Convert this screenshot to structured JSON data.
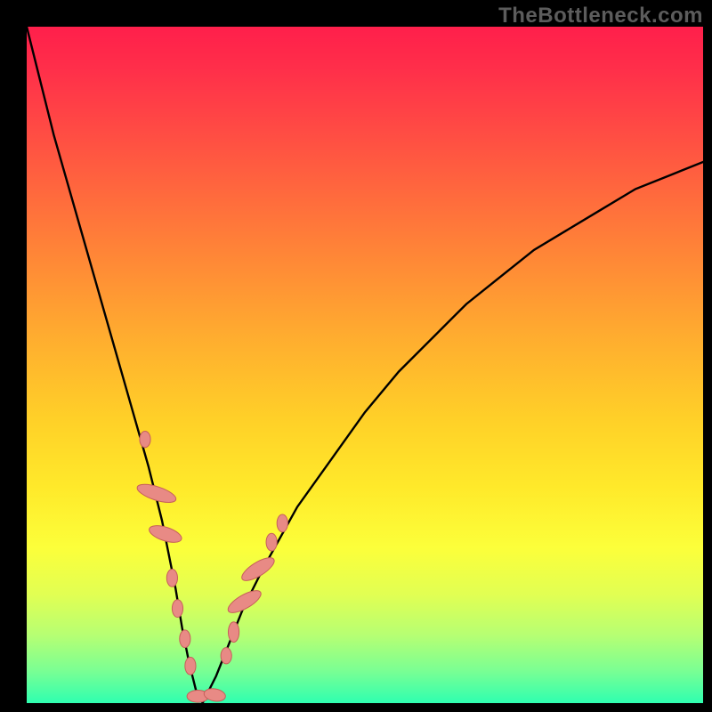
{
  "watermark": "TheBottleneck.com",
  "chart_data": {
    "type": "line",
    "title": "",
    "xlabel": "",
    "ylabel": "",
    "xlim": [
      0,
      100
    ],
    "ylim": [
      0,
      100
    ],
    "grid": false,
    "legend": false,
    "series": [
      {
        "name": "bottleneck-curve",
        "x": [
          0,
          2,
          4,
          6,
          8,
          10,
          12,
          14,
          16,
          18,
          20,
          21,
          22,
          23,
          24,
          25,
          26,
          28,
          30,
          32,
          35,
          40,
          45,
          50,
          55,
          60,
          65,
          70,
          75,
          80,
          85,
          90,
          95,
          100
        ],
        "y": [
          100,
          92,
          84,
          77,
          70,
          63,
          56,
          49,
          42,
          35,
          27,
          22,
          17,
          11,
          6,
          2,
          0,
          4,
          9,
          14,
          20,
          29,
          36,
          43,
          49,
          54,
          59,
          63,
          67,
          70,
          73,
          76,
          78,
          80
        ]
      }
    ],
    "markers": [
      {
        "name": "marker-left-outer",
        "shape": "round",
        "x": 17.5,
        "y": 39,
        "w": 1.6,
        "h": 2.4
      },
      {
        "name": "marker-left-long-1",
        "shape": "pill",
        "x": 19.2,
        "y": 31,
        "w": 2.0,
        "h": 6.0,
        "angle": -72
      },
      {
        "name": "marker-left-long-2",
        "shape": "pill",
        "x": 20.5,
        "y": 25,
        "w": 2.0,
        "h": 5.0,
        "angle": -72
      },
      {
        "name": "marker-left-3",
        "shape": "round",
        "x": 21.5,
        "y": 18.5,
        "w": 1.6,
        "h": 2.6
      },
      {
        "name": "marker-left-4",
        "shape": "round",
        "x": 22.3,
        "y": 14,
        "w": 1.6,
        "h": 2.6
      },
      {
        "name": "marker-left-5",
        "shape": "round",
        "x": 23.4,
        "y": 9.5,
        "w": 1.6,
        "h": 2.6
      },
      {
        "name": "marker-left-6",
        "shape": "round",
        "x": 24.2,
        "y": 5.5,
        "w": 1.6,
        "h": 2.6
      },
      {
        "name": "marker-bottom-1",
        "shape": "pill",
        "x": 25.3,
        "y": 1.0,
        "w": 3.2,
        "h": 1.8,
        "angle": 0
      },
      {
        "name": "marker-bottom-2",
        "shape": "pill",
        "x": 27.8,
        "y": 1.2,
        "w": 3.2,
        "h": 1.8,
        "angle": 10
      },
      {
        "name": "marker-right-1",
        "shape": "round",
        "x": 29.5,
        "y": 7.0,
        "w": 1.6,
        "h": 2.4
      },
      {
        "name": "marker-right-2",
        "shape": "round",
        "x": 30.6,
        "y": 10.5,
        "w": 1.6,
        "h": 3.0
      },
      {
        "name": "marker-right-long-1",
        "shape": "pill",
        "x": 32.2,
        "y": 15.0,
        "w": 2.0,
        "h": 5.5,
        "angle": 60
      },
      {
        "name": "marker-right-long-2",
        "shape": "pill",
        "x": 34.2,
        "y": 19.8,
        "w": 2.0,
        "h": 5.5,
        "angle": 58
      },
      {
        "name": "marker-right-3",
        "shape": "round",
        "x": 36.2,
        "y": 23.8,
        "w": 1.6,
        "h": 2.6
      },
      {
        "name": "marker-right-4",
        "shape": "round",
        "x": 37.8,
        "y": 26.6,
        "w": 1.6,
        "h": 2.6
      }
    ],
    "colors": {
      "curve": "#000000",
      "marker_fill": "#e88a85",
      "marker_stroke": "#c65f5a",
      "bg_top": "#ff1f4b",
      "bg_bottom": "#2fffb0"
    }
  }
}
